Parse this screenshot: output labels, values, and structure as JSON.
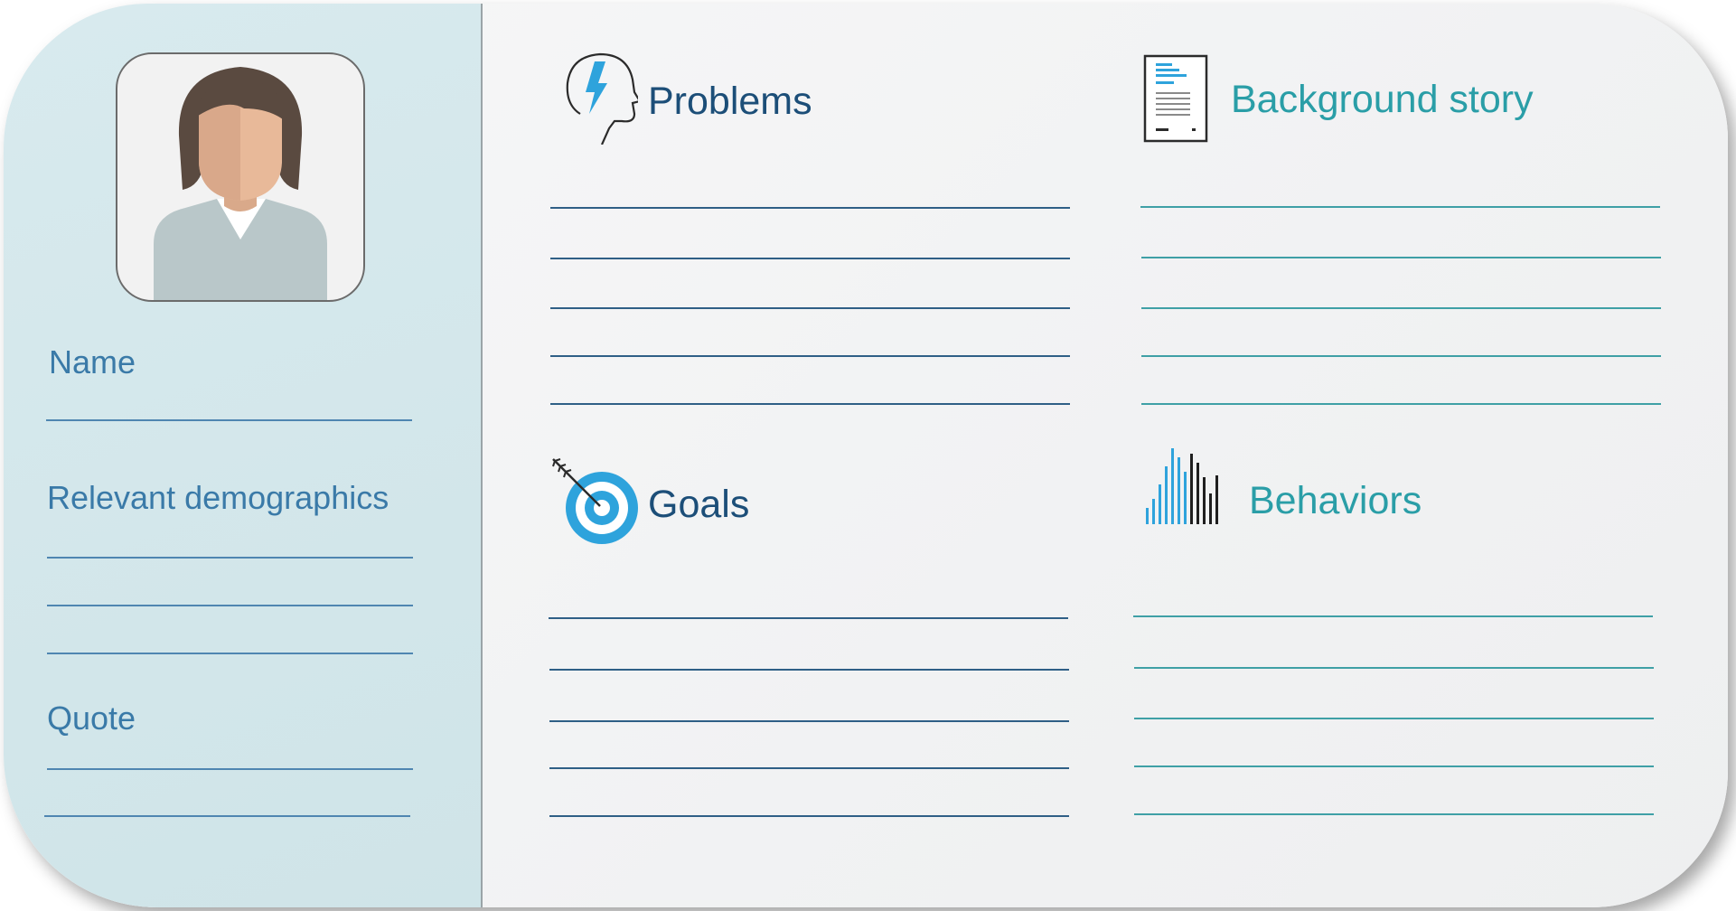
{
  "persona": {
    "name_label": "Name",
    "demographics_label": "Relevant demographics",
    "quote_label": "Quote"
  },
  "sections": {
    "problems": "Problems",
    "background": "Background story",
    "goals": "Goals",
    "behaviors": "Behaviors"
  },
  "colors": {
    "left_panel": "#d4e8ec",
    "heading_dark": "#1c4e78",
    "heading_teal": "#2a9ea7",
    "label": "#3a7aa8",
    "icon_accent": "#2ea3dc"
  },
  "icons": {
    "problems": "head-lightning-icon",
    "background": "document-icon",
    "goals": "target-arrow-icon",
    "behaviors": "bar-chart-icon",
    "avatar": "avatar-woman"
  }
}
